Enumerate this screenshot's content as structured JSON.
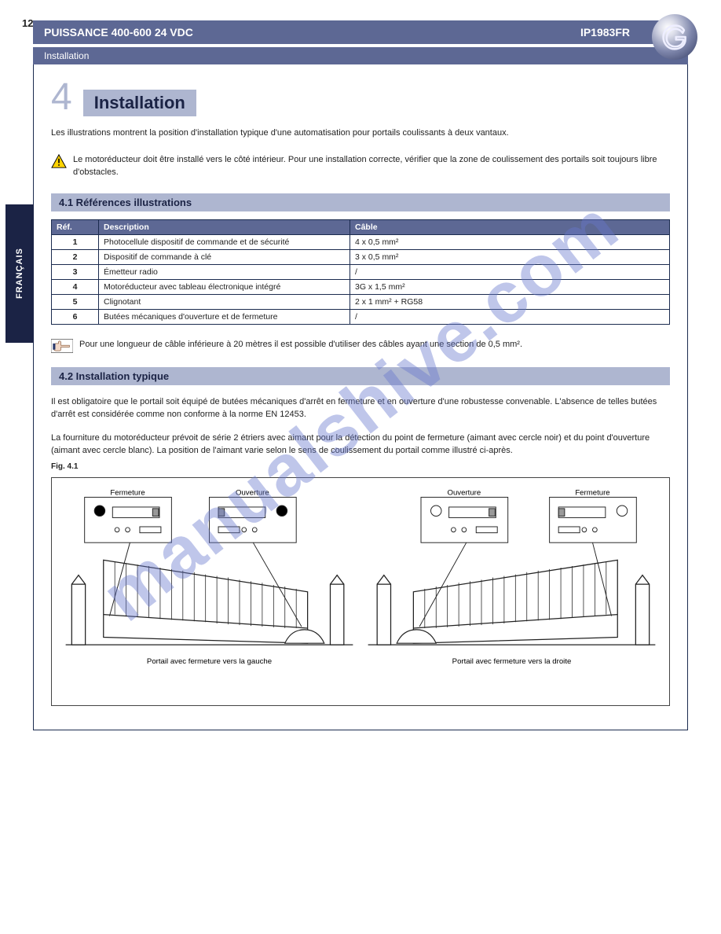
{
  "page_number": "12",
  "header": {
    "title_left": "PUISSANCE 400-600 24 VDC",
    "title_right": "IP1983FR",
    "sub": "Installation"
  },
  "side_tab": "FRANÇAIS",
  "logo_letter": "G",
  "chapter": {
    "num": "4",
    "title": "Installation"
  },
  "para1": "Les illustrations montrent la position d'installation typique d'une automatisation pour portails coulissants à deux vantaux.",
  "warning": "Le motoréducteur doit être installé vers le côté intérieur. Pour une installation correcte, vérifier que la zone de coulissement des portails soit toujours libre d'obstacles.",
  "section_41": "4.1 Références illustrations",
  "table": {
    "headers": [
      "Réf.",
      "Description",
      "Câble"
    ],
    "rows": [
      [
        "1",
        "Photocellule dispositif de commande et de sécurité",
        "4 x 0,5 mm²"
      ],
      [
        "2",
        "Dispositif de commande à clé",
        "3 x 0,5 mm²"
      ],
      [
        "3",
        "Émetteur radio",
        "/"
      ],
      [
        "4",
        "Motoréducteur avec tableau électronique intégré",
        "3G x 1,5 mm²"
      ],
      [
        "5",
        "Clignotant",
        "2 x 1 mm² + RG58"
      ],
      [
        "6",
        "Butées mécaniques d'ouverture et de fermeture",
        "/"
      ]
    ]
  },
  "note": "Pour une longueur de câble inférieure à 20 mètres il est possible d'utiliser des câbles ayant une section de 0,5 mm².",
  "section_42": "4.2 Installation typique",
  "para2": "Il est obligatoire que le portail soit équipé de butées mécaniques d'arrêt en fermeture et en ouverture d'une robustesse convenable. L'absence de telles butées d'arrêt est considérée comme non conforme à la norme EN 12453.",
  "para3": "La fourniture du motoréducteur prévoit de série 2 étriers avec aimant pour la détection du point de fermeture (aimant avec cercle noir) et du point d'ouverture (aimant avec cercle blanc). La position de l'aimant varie selon le sens de coulissement du portail comme illustré ci-après.",
  "fig_label": "Fig. 4.1",
  "captions": {
    "f_black": "Fermeture",
    "o_black": "Ouverture",
    "o_white": "Ouverture",
    "f_white": "Fermeture",
    "left": "Portail avec fermeture vers la gauche",
    "right": "Portail avec fermeture vers la droite"
  },
  "watermark": "manualshive.com"
}
